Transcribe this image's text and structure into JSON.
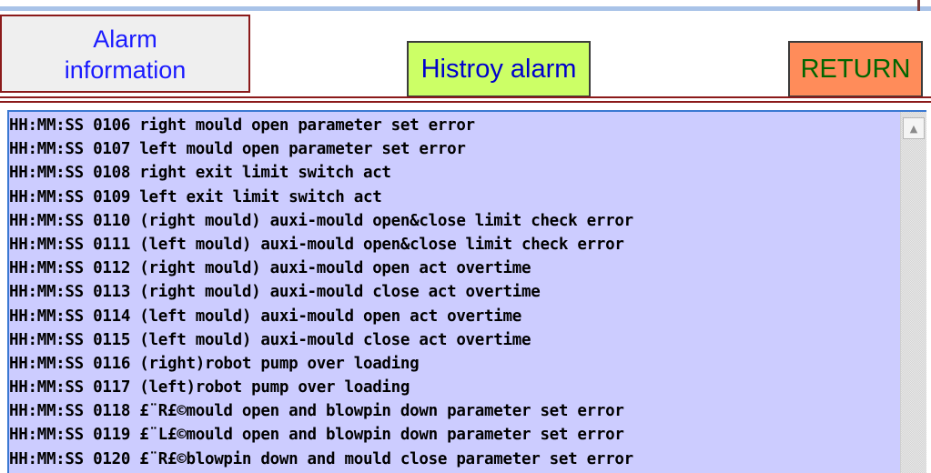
{
  "header": {
    "alarm_info_label": "Alarm\ninformation",
    "history_label": "Histroy alarm",
    "return_label": "RETURN"
  },
  "scrollbar": {
    "up_icon": "arrow-up-icon",
    "up_glyph": "▲"
  },
  "alarms": [
    "HH:MM:SS 0106 right mould open parameter set error",
    "HH:MM:SS 0107 left mould open parameter set error",
    "HH:MM:SS 0108 right exit limit switch act",
    "HH:MM:SS 0109 left exit limit switch act",
    "HH:MM:SS 0110 (right mould) auxi-mould open&close limit check error",
    "HH:MM:SS 0111 (left mould) auxi-mould open&close limit check error",
    "HH:MM:SS 0112 (right mould) auxi-mould open act overtime",
    "HH:MM:SS 0113 (right mould) auxi-mould close act overtime",
    "HH:MM:SS 0114 (left mould) auxi-mould open act overtime",
    "HH:MM:SS 0115 (left mould) auxi-mould close act overtime",
    "HH:MM:SS 0116 (right)robot pump over loading",
    "HH:MM:SS 0117 (left)robot pump over loading",
    "HH:MM:SS 0118 £¨R£©mould open and blowpin down parameter set error",
    "HH:MM:SS 0119 £¨L£©mould open and blowpin down parameter set error",
    "HH:MM:SS 0120 £¨R£©blowpin down and mould close parameter set error"
  ],
  "colors": {
    "list_background": "#ccccff",
    "alarm_button_text": "#1a1aff",
    "history_button_bg": "#ccff66",
    "return_button_bg": "#ff8c5a",
    "return_button_text": "#006600",
    "separator": "#8b1a1a"
  }
}
